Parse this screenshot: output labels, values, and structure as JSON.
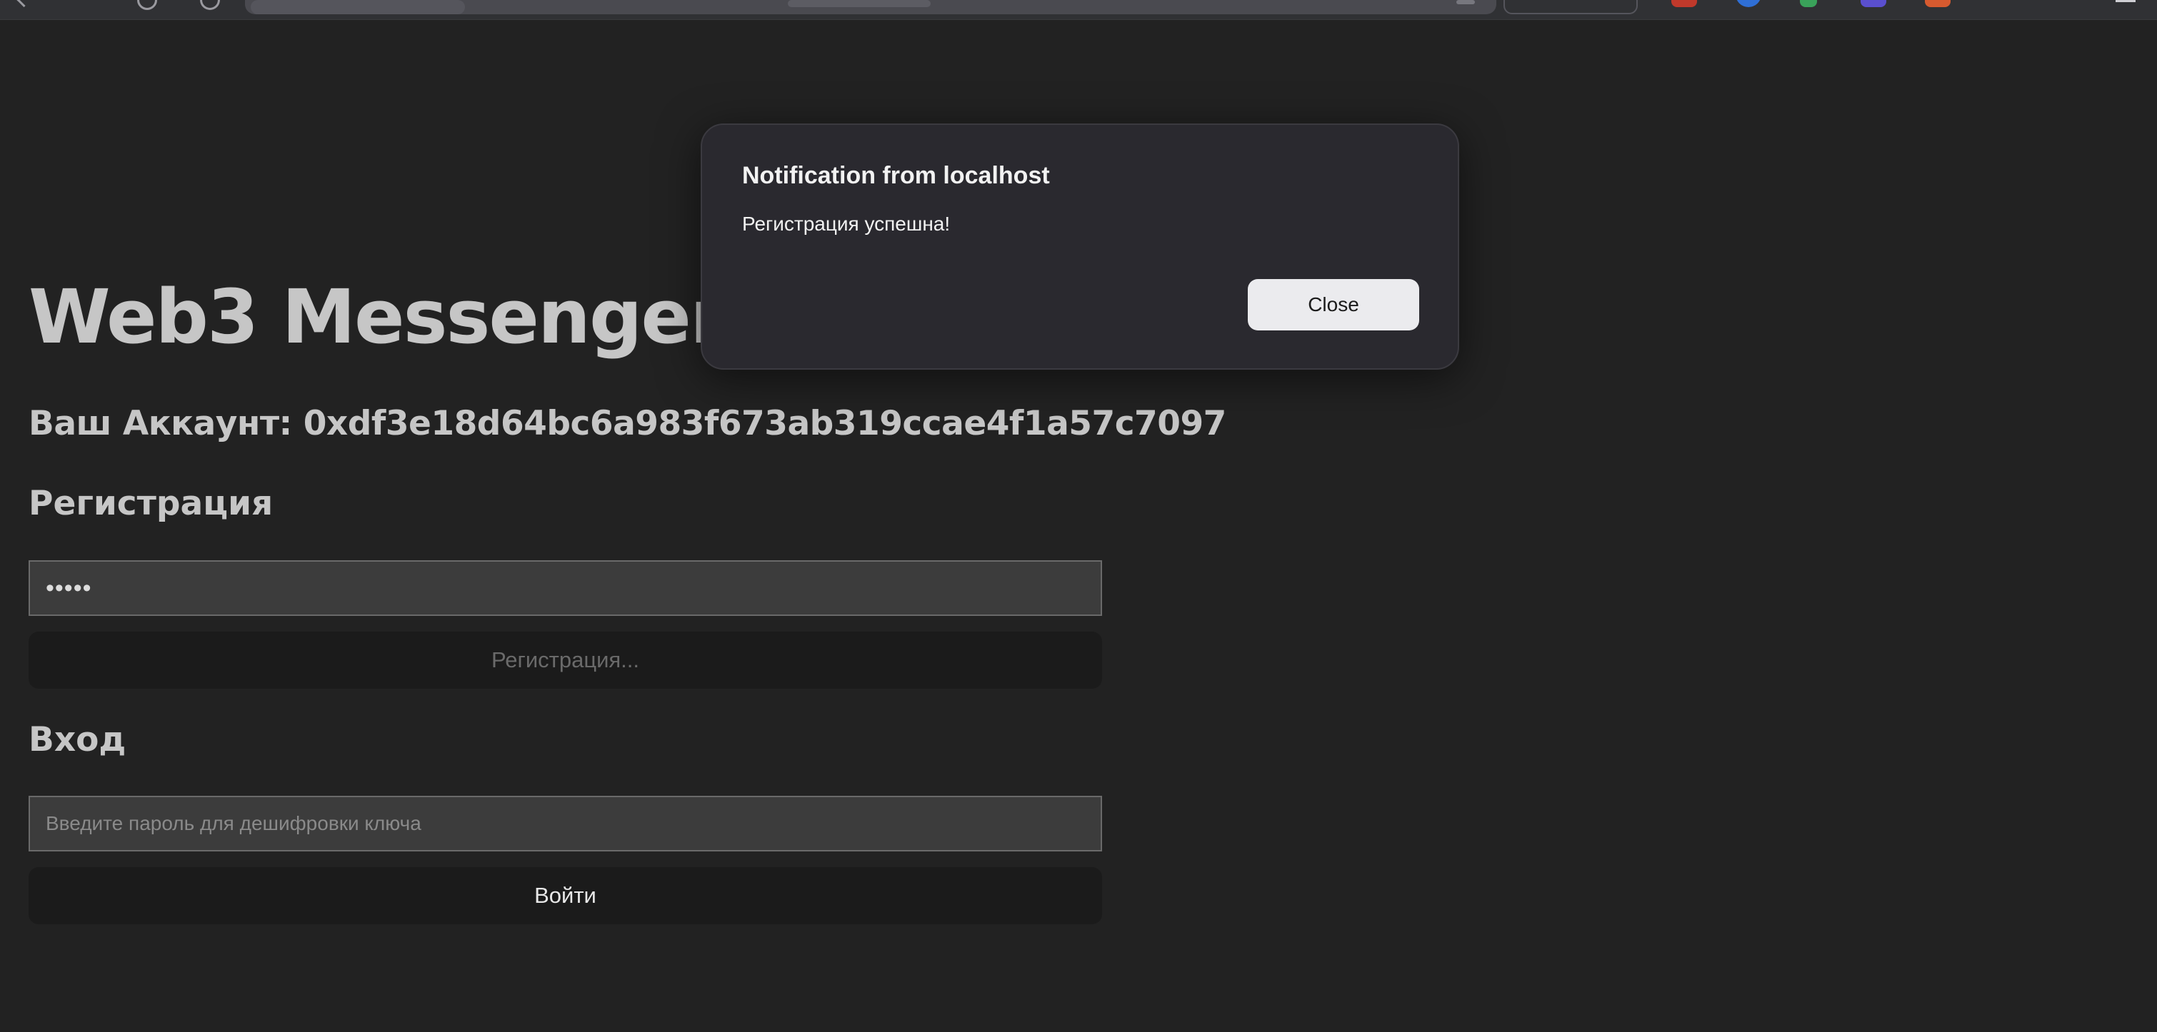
{
  "app": {
    "title": "Web3 Messenger",
    "account_line": "Ваш Аккаунт: 0xdf3e18d64bc6a983f673ab319ccae4f1a57c7097"
  },
  "registration": {
    "heading": "Регистрация",
    "password_value": "•••••",
    "button_label": "Регистрация..."
  },
  "login": {
    "heading": "Вход",
    "password_placeholder": "Введите пароль для дешифровки ключа",
    "button_label": "Войти"
  },
  "dialog": {
    "title": "Notification from localhost",
    "message": "Регистрация успешна!",
    "close_label": "Close"
  },
  "browser": {
    "extension_icons": [
      "ext-red-icon",
      "ext-blue-icon",
      "ext-green-icon",
      "ext-purple-icon",
      "ext-orange-icon"
    ],
    "colors": {
      "ext_red": "#c0392b",
      "ext_blue": "#2f6fd6",
      "ext_green": "#3aa25a",
      "ext_purple": "#5a4fcf",
      "ext_orange": "#d65a2f"
    }
  },
  "colors": {
    "background": "#222222",
    "text": "#c6c6c6",
    "dialog_bg": "#2a292f",
    "button_bg": "#1b1b1b"
  }
}
